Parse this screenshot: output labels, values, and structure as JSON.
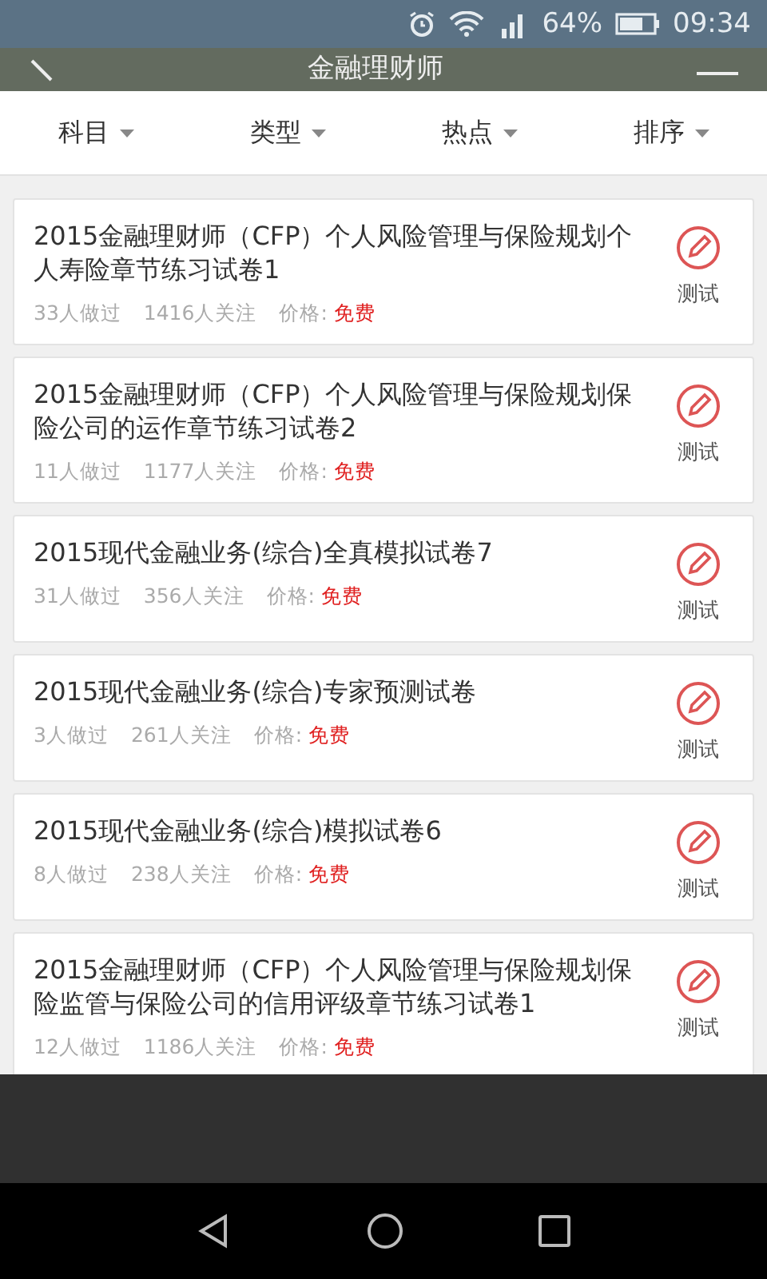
{
  "status_bar": {
    "battery": "64%",
    "time": "09:34"
  },
  "title_bar": {
    "title": "金融理财师"
  },
  "filters": [
    {
      "label": "科目"
    },
    {
      "label": "类型"
    },
    {
      "label": "热点"
    },
    {
      "label": "排序"
    }
  ],
  "papers": [
    {
      "title": "2015金融理财师（CFP）个人风险管理与保险规划个人寿险章节练习试卷1",
      "done": "33人做过",
      "followers": "1416人关注",
      "price_label": "价格:",
      "price": "免费",
      "action": "测试"
    },
    {
      "title": "2015金融理财师（CFP）个人风险管理与保险规划保险公司的运作章节练习试卷2",
      "done": "11人做过",
      "followers": "1177人关注",
      "price_label": "价格:",
      "price": "免费",
      "action": "测试"
    },
    {
      "title": "2015现代金融业务(综合)全真模拟试卷7",
      "done": "31人做过",
      "followers": "356人关注",
      "price_label": "价格:",
      "price": "免费",
      "action": "测试"
    },
    {
      "title": "2015现代金融业务(综合)专家预测试卷",
      "done": "3人做过",
      "followers": "261人关注",
      "price_label": "价格:",
      "price": "免费",
      "action": "测试"
    },
    {
      "title": "2015现代金融业务(综合)模拟试卷6",
      "done": "8人做过",
      "followers": "238人关注",
      "price_label": "价格:",
      "price": "免费",
      "action": "测试"
    },
    {
      "title": "2015金融理财师（CFP）个人风险管理与保险规划保险监管与保险公司的信用评级章节练习试卷1",
      "done": "12人做过",
      "followers": "1186人关注",
      "price_label": "价格:",
      "price": "免费",
      "action": "测试"
    }
  ]
}
